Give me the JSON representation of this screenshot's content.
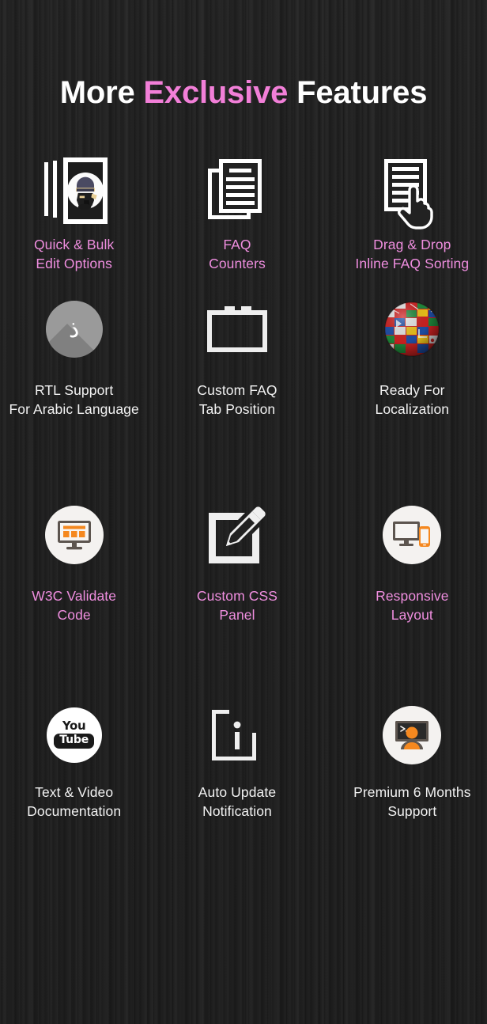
{
  "heading": {
    "part1": "More ",
    "accent": "Exclusive",
    "part2": " Features"
  },
  "colors": {
    "background": "#242424",
    "accent_pink": "#ef8edf",
    "heading_pink": "#f27fd8",
    "text_white": "#f2f2f2",
    "icon_orange": "#f5881f",
    "icon_gray": "#5d554f"
  },
  "features": [
    {
      "icon": "stacked-documents-ninja-icon",
      "label": "Quick & Bulk\nEdit Options",
      "label_color": "pink"
    },
    {
      "icon": "stacked-documents-lines-icon",
      "label": "FAQ\nCounters",
      "label_color": "pink"
    },
    {
      "icon": "document-hand-drag-icon",
      "label": "Drag & Drop\nInline FAQ Sorting",
      "label_color": "pink"
    },
    {
      "icon": "arabic-letter-circle-icon",
      "label": "RTL Support\nFor Arabic Language",
      "label_color": "white"
    },
    {
      "icon": "tab-position-box-icon",
      "label": "Custom FAQ\nTab Position",
      "label_color": "white"
    },
    {
      "icon": "flags-globe-icon",
      "label": "Ready For\nLocalization",
      "label_color": "white"
    },
    {
      "icon": "monitor-validate-icon",
      "label": "W3C Validate\nCode",
      "label_color": "pink"
    },
    {
      "icon": "square-pencil-edit-icon",
      "label": "Custom CSS\nPanel",
      "label_color": "pink"
    },
    {
      "icon": "monitor-mobile-responsive-icon",
      "label": "Responsive\nLayout",
      "label_color": "pink"
    },
    {
      "icon": "youtube-logo-icon",
      "label": "Text & Video\nDocumentation",
      "label_color": "white"
    },
    {
      "icon": "info-bracket-icon",
      "label": "Auto Update\nNotification",
      "label_color": "white"
    },
    {
      "icon": "support-agent-monitor-icon",
      "label": "Premium 6 Months\nSupport",
      "label_color": "white"
    }
  ]
}
